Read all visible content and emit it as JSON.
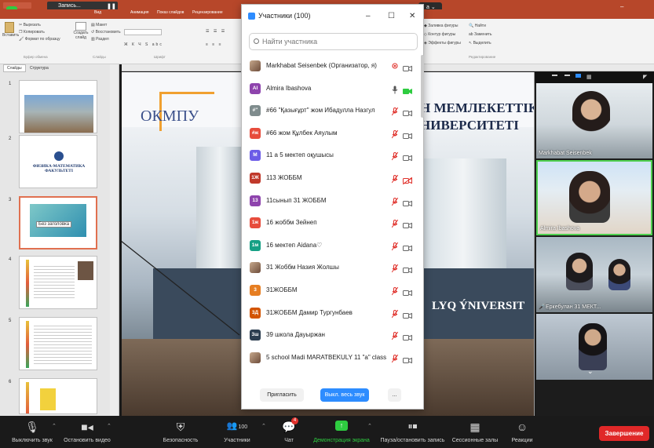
{
  "ppt": {
    "record_tab": "Запись...",
    "ribbon_tabs": [
      "Вид",
      "Анимация",
      "Показ слайдов",
      "Рецензирование"
    ],
    "clipboard": {
      "cut": "Вырезать",
      "copy": "Копировать",
      "format_painter": "Формат по образцу",
      "paste": "Вставить",
      "group": "Буфер обмена"
    },
    "slides_group": {
      "layout": "Макет",
      "reset": "Восстановить",
      "new_slide": "Создать слайд",
      "section": "Раздел",
      "group": "Слайды"
    },
    "font_group": "Шрифт",
    "right_ribbon": {
      "fill": "Заливка фигуры",
      "outline": "Контур фигуры",
      "effects": "Эффекты фигуры",
      "find": "Найти",
      "replace": "Заменить",
      "select": "Выделить",
      "editing": "Редактирование"
    },
    "panel_tabs": {
      "slides": "Слайды",
      "outline": "Структура"
    },
    "slide_numbers": [
      "1",
      "2",
      "3",
      "4",
      "5",
      "6"
    ],
    "thumb2_caption": "ФИЗИКА-МАТЕМАТИКА ФАКУЛЬТЕТІ",
    "thumb3_caption": "Без заголовка",
    "slide": {
      "logo_text": "ОКМПУ",
      "title_line1": "Н МЕМЛЕКЕТТІК",
      "title_line2": "НИВЕРСИТЕТІ",
      "building_sign": "LYQ ÝNIVERSIT"
    }
  },
  "participants": {
    "title": "Участники (100)",
    "search_placeholder": "Найти участника",
    "invite_label": "Пригласить",
    "mute_all_label": "Выкл. весь звук",
    "more_label": "...",
    "list": [
      {
        "initials": "",
        "color": "",
        "name": "Markhabat Seisenbek (Организатор, я)",
        "mic": "active",
        "cam": "off"
      },
      {
        "initials": "AI",
        "color": "#8e44ad",
        "name": "Almira Ibashova",
        "mic": "on",
        "cam": "video-on"
      },
      {
        "initials": "#\"",
        "color": "#7f8c8d",
        "name": "#66 \"Қазығұрт\" жом Ибадулла Назгул",
        "mic": "muted",
        "cam": "off"
      },
      {
        "initials": "#ж",
        "color": "#e74c3c",
        "name": "#66 жом Құлбек Аяулым",
        "mic": "muted",
        "cam": "off"
      },
      {
        "initials": "M",
        "color": "#6c5ce7",
        "name": "11 а 5 мектеп оқушысы",
        "mic": "muted",
        "cam": "off"
      },
      {
        "initials": "1Ж",
        "color": "#c0392b",
        "name": "113 ЖОББМ",
        "mic": "muted",
        "cam": "cam-muted"
      },
      {
        "initials": "13",
        "color": "#8e44ad",
        "name": "11сынып 31 ЖОББМ",
        "mic": "muted",
        "cam": "off"
      },
      {
        "initials": "1ж",
        "color": "#e74c3c",
        "name": "16 жоббм  Зейнеп",
        "mic": "muted",
        "cam": "off"
      },
      {
        "initials": "1м",
        "color": "#16a085",
        "name": "16 мектеп Aidana♡",
        "mic": "muted",
        "cam": "off"
      },
      {
        "initials": "",
        "color": "",
        "name": "31 Жоббм Назия Жолшы",
        "mic": "muted",
        "cam": "off"
      },
      {
        "initials": "3",
        "color": "#e67e22",
        "name": "31ЖОББМ",
        "mic": "muted",
        "cam": "off"
      },
      {
        "initials": "3Д",
        "color": "#d35400",
        "name": "31ЖОББМ Дамир Тургунбаев",
        "mic": "muted",
        "cam": "off"
      },
      {
        "initials": "3ш",
        "color": "#2c3e50",
        "name": "39 школа Дауыржан",
        "mic": "muted",
        "cam": "off"
      },
      {
        "initials": "",
        "color": "",
        "name": "5 school Madi MARATBEKULY 11 \"a\" class",
        "mic": "muted",
        "cam": "off"
      }
    ]
  },
  "video_panel": {
    "tiles": [
      {
        "name": "Markhabat Seisenbek"
      },
      {
        "name": "Almira Ibashova"
      },
      {
        "name": "Еркебулан 31 МЕКТ..."
      },
      {
        "name": ""
      }
    ]
  },
  "zoom_bar": {
    "mute": "Выключить звук",
    "stop_video": "Остановить видео",
    "security": "Безопасность",
    "participants": "Участники",
    "participants_count": "100",
    "chat": "Чат",
    "chat_badge": "4",
    "share": "Демонстрация экрана",
    "record": "Пауза/остановить запись",
    "breakout": "Сессионные залы",
    "reactions": "Реакции",
    "end": "Завершение"
  },
  "colors": {
    "ppt_accent": "#b7472a",
    "zoom_blue": "#2d8cff",
    "share_green": "#2ecc40",
    "end_red": "#e02828",
    "muted_red": "#e0312b"
  }
}
